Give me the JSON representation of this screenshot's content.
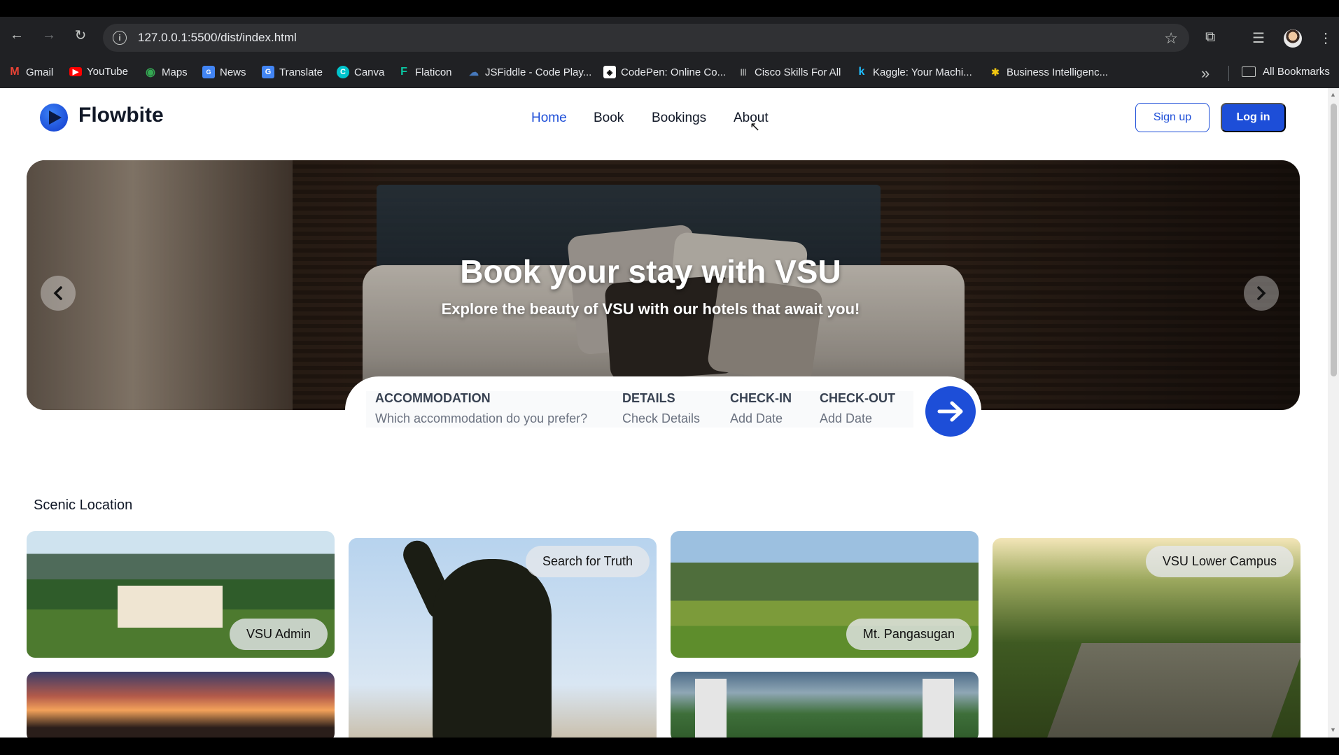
{
  "browser": {
    "url": "127.0.0.1:5500/dist/index.html",
    "bookmarks": [
      {
        "label": "Gmail",
        "icon": "gmail-icon",
        "color": "#ea4335"
      },
      {
        "label": "YouTube",
        "icon": "youtube-icon",
        "color": "#ff0000"
      },
      {
        "label": "Maps",
        "icon": "maps-icon",
        "color": "#34a853"
      },
      {
        "label": "News",
        "icon": "news-icon",
        "color": "#4285f4"
      },
      {
        "label": "Translate",
        "icon": "translate-icon",
        "color": "#4285f4"
      },
      {
        "label": "Canva",
        "icon": "canva-icon",
        "color": "#00c4cc"
      },
      {
        "label": "Flaticon",
        "icon": "flaticon-icon",
        "color": "#0ac7a3"
      },
      {
        "label": "JSFiddle - Code Play...",
        "icon": "jsfiddle-icon",
        "color": "#4679bd"
      },
      {
        "label": "CodePen: Online Co...",
        "icon": "codepen-icon",
        "color": "#ffffff"
      },
      {
        "label": "Cisco Skills For All",
        "icon": "cisco-icon",
        "color": "#049fd9"
      },
      {
        "label": "Kaggle: Your Machi...",
        "icon": "kaggle-icon",
        "color": "#20beff"
      },
      {
        "label": "Business Intelligenc...",
        "icon": "bi-icon",
        "color": "#f2c811"
      }
    ],
    "all_bookmarks": "All Bookmarks"
  },
  "navbar": {
    "brand": "Flowbite",
    "links": [
      "Home",
      "Book",
      "Bookings",
      "About"
    ],
    "active_link": "Home",
    "signup": "Sign up",
    "login": "Log in",
    "accent_color": "#1d4ed8"
  },
  "hero": {
    "title": "Book your stay with VSU",
    "subtitle": "Explore the beauty of VSU with our hotels that await you!"
  },
  "booking": {
    "columns": [
      {
        "heading": "ACCOMMODATION",
        "value": "Which accommodation do you prefer?"
      },
      {
        "heading": "DETAILS",
        "value": "Check Details"
      },
      {
        "heading": "CHECK-IN",
        "value": "Add Date"
      },
      {
        "heading": "CHECK-OUT",
        "value": "Add Date"
      }
    ]
  },
  "scenic": {
    "title": "Scenic Location",
    "cards": [
      {
        "label": "VSU Admin"
      },
      {
        "label": "Search for Truth"
      },
      {
        "label": "Mt. Pangasugan"
      },
      {
        "label": "VSU Lower Campus"
      }
    ]
  }
}
